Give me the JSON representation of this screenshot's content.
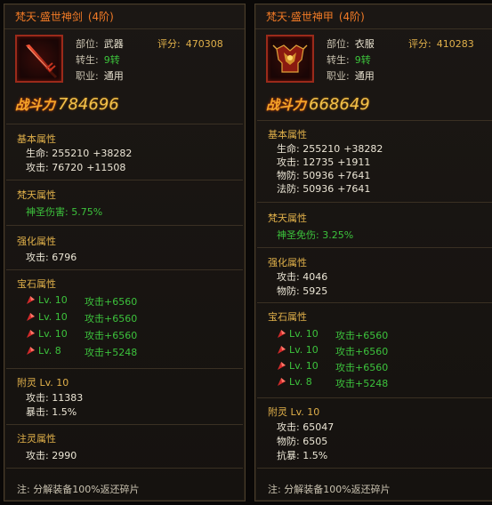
{
  "left": {
    "title": "梵天·盛世神剑",
    "tier": "(4阶)",
    "icon": "sword-icon",
    "meta": {
      "slot_label": "部位:",
      "slot_value": "武器",
      "rebirth_label": "转生:",
      "rebirth_value": "9转",
      "job_label": "职业:",
      "job_value": "通用",
      "score_label": "评分:",
      "score_value": "470308"
    },
    "power_label": "战斗力",
    "power_value": "784696",
    "basic": {
      "title": "基本属性",
      "lines": [
        {
          "text": "生命: 255210",
          "plus": "+38282"
        },
        {
          "text": "攻击: 76720",
          "plus": "+11508"
        }
      ]
    },
    "fantian": {
      "title": "梵天属性",
      "line": "神圣伤害: 5.75%"
    },
    "enhance": {
      "title": "强化属性",
      "lines": [
        "攻击: 6796"
      ]
    },
    "gem": {
      "title": "宝石属性",
      "items": [
        {
          "lv": "Lv. 10",
          "val": "攻击+6560"
        },
        {
          "lv": "Lv. 10",
          "val": "攻击+6560"
        },
        {
          "lv": "Lv. 10",
          "val": "攻击+6560"
        },
        {
          "lv": "Lv. 8",
          "val": "攻击+5248"
        }
      ]
    },
    "spirit": {
      "title": "附灵 Lv. 10",
      "lines": [
        "攻击: 11383",
        "暴击: 1.5%"
      ]
    },
    "infuse": {
      "title": "注灵属性",
      "lines": [
        "攻击: 2990"
      ]
    },
    "note": "注: 分解装备100%返还碎片"
  },
  "right": {
    "title": "梵天·盛世神甲",
    "tier": "(4阶)",
    "icon": "armor-icon",
    "meta": {
      "slot_label": "部位:",
      "slot_value": "衣服",
      "rebirth_label": "转生:",
      "rebirth_value": "9转",
      "job_label": "职业:",
      "job_value": "通用",
      "score_label": "评分:",
      "score_value": "410283"
    },
    "power_label": "战斗力",
    "power_value": "668649",
    "basic": {
      "title": "基本属性",
      "lines": [
        {
          "text": "生命: 255210",
          "plus": "+38282"
        },
        {
          "text": "攻击: 12735",
          "plus": "+1911"
        },
        {
          "text": "物防: 50936",
          "plus": "+7641"
        },
        {
          "text": "法防: 50936",
          "plus": "+7641"
        }
      ]
    },
    "fantian": {
      "title": "梵天属性",
      "line": "神圣免伤: 3.25%"
    },
    "enhance": {
      "title": "强化属性",
      "lines": [
        "攻击: 4046",
        "物防: 5925"
      ]
    },
    "gem": {
      "title": "宝石属性",
      "items": [
        {
          "lv": "Lv. 10",
          "val": "攻击+6560"
        },
        {
          "lv": "Lv. 10",
          "val": "攻击+6560"
        },
        {
          "lv": "Lv. 10",
          "val": "攻击+6560"
        },
        {
          "lv": "Lv. 8",
          "val": "攻击+5248"
        }
      ]
    },
    "spirit": {
      "title": "附灵 Lv. 10",
      "lines": [
        "攻击: 65047",
        "物防: 6505",
        "抗暴: 1.5%"
      ]
    },
    "note": "注: 分解装备100%返还碎片"
  }
}
